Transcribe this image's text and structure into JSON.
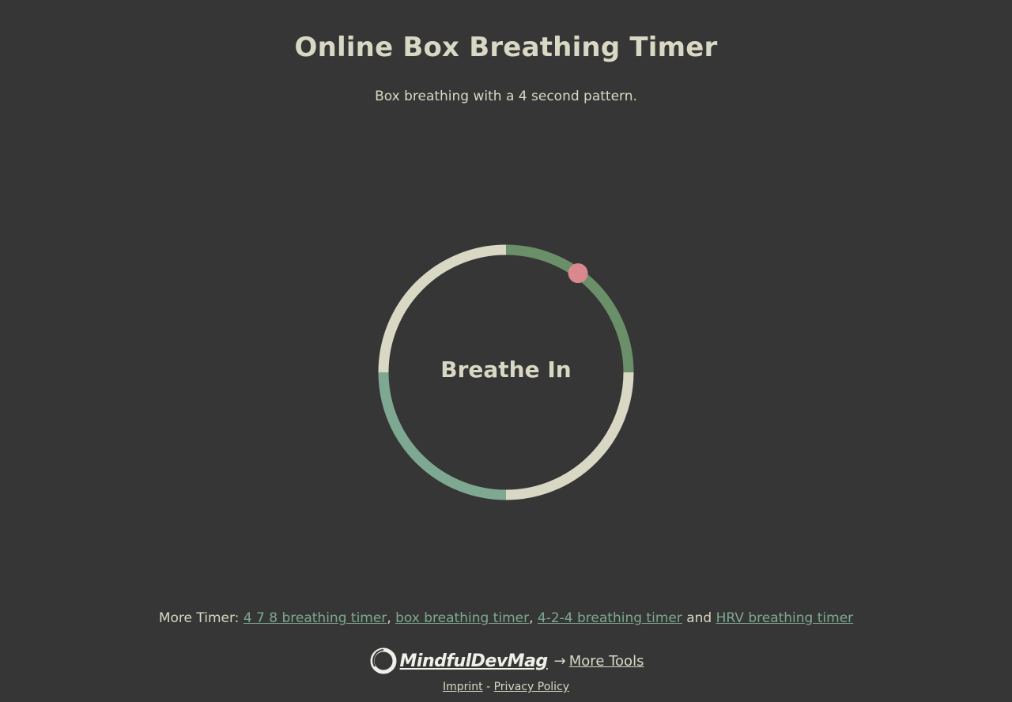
{
  "header": {
    "title": "Online Box Breathing Timer",
    "subtitle": "Box breathing with a 4 second pattern."
  },
  "timer": {
    "phase_label": "Breathe In",
    "progress_in_phase": 0.4,
    "colors": {
      "inhale_segment": "#6b8f68",
      "hold_segment": "#d8d8c4",
      "exhale_segment": "#7ea892",
      "indicator": "#d9888e"
    }
  },
  "more_timers": {
    "prefix": "More Timer:",
    "links": [
      "4 7 8 breathing timer",
      "box breathing timer",
      "4-2-4 breathing timer",
      "HRV breathing timer"
    ],
    "separator": ",",
    "conjunction": "and"
  },
  "brand": {
    "logo_text": "MindfulDevMag",
    "logo_icon": "ring-logo-icon",
    "arrow": "→",
    "more_tools_label": "More Tools"
  },
  "legal": {
    "imprint_label": "Imprint",
    "separator": "-",
    "privacy_label": "Privacy Policy"
  }
}
